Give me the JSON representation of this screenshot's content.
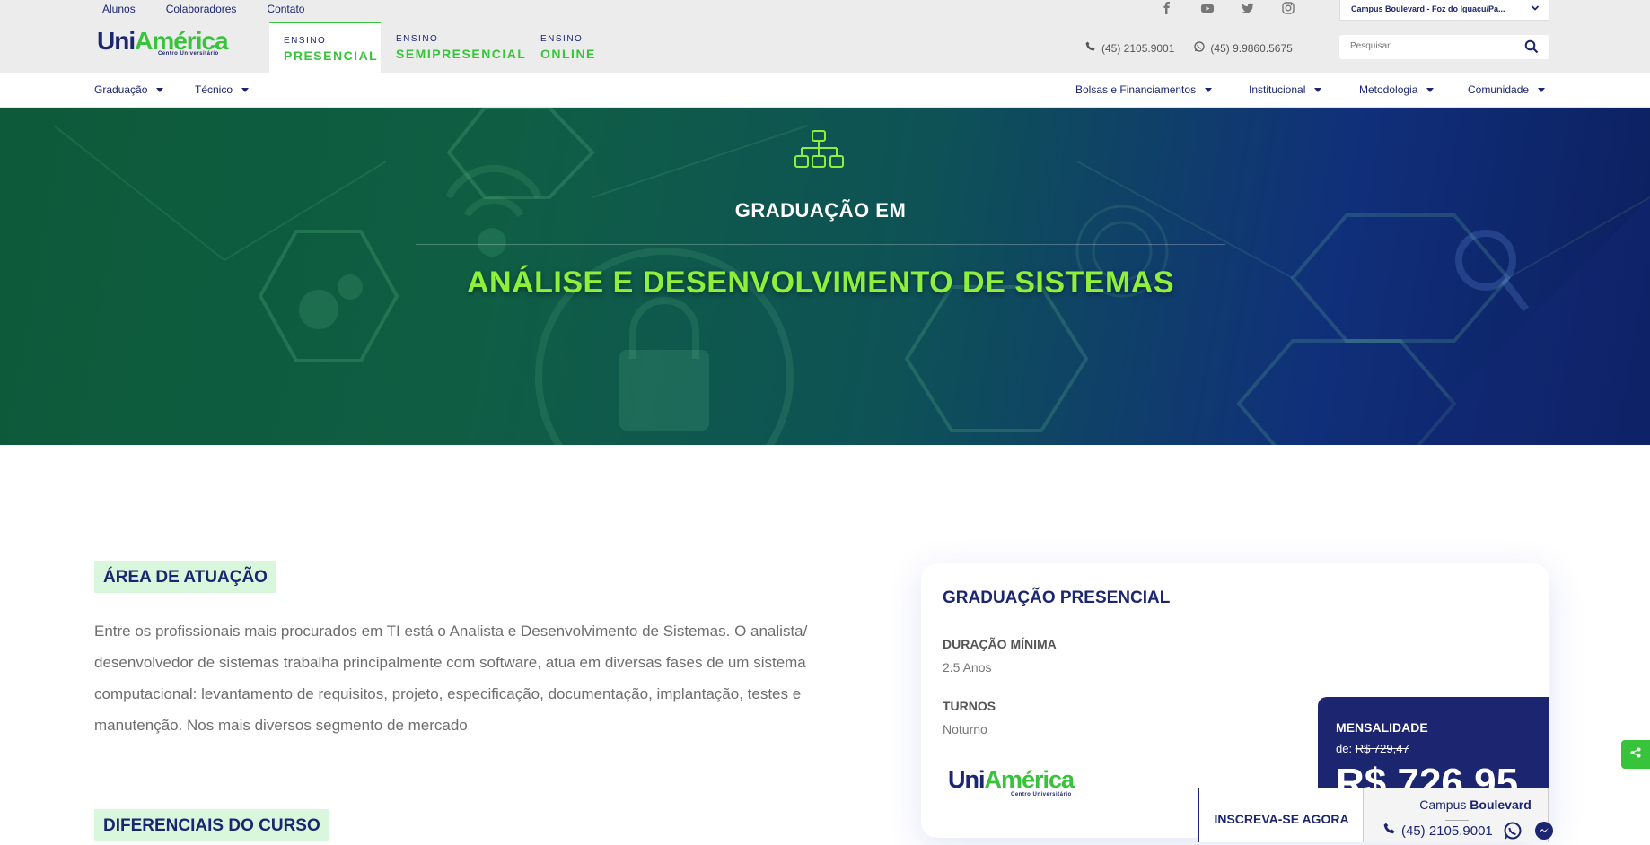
{
  "top_links": [
    "Alunos",
    "Colaboradores",
    "Contato"
  ],
  "brand": {
    "uni": "Uni",
    "america": "América",
    "sub": "Centro Universitário"
  },
  "ensino": [
    {
      "k": "ENSINO",
      "v": "PRESENCIAL"
    },
    {
      "k": "ENSINO",
      "v": "SEMIPRESENCIAL"
    },
    {
      "k": "ENSINO",
      "v": "ONLINE"
    }
  ],
  "social_icons": [
    "facebook-icon",
    "youtube-icon",
    "twitter-icon",
    "instagram-icon"
  ],
  "campus_select": "Campus Boulevard - Foz do Iguaçu/Pa...",
  "phones": {
    "phone": "(45) 2105.9001",
    "whatsapp": "(45) 9.9860.5675"
  },
  "search": {
    "placeholder": "Pesquisar"
  },
  "nav_left": [
    "Graduação",
    "Técnico"
  ],
  "nav_right": [
    "Bolsas e Financiamentos",
    "Institucional",
    "Metodologia",
    "Comunidade"
  ],
  "hero": {
    "subtitle": "GRADUAÇÃO EM",
    "title": "ANÁLISE E DESENVOLVIMENTO DE SISTEMAS"
  },
  "area": {
    "heading": "ÁREA DE ATUAÇÃO",
    "text": "Entre os profissionais mais procurados em TI está o Analista e Desenvolvimento de Sistemas. O analista/ desenvolvedor de sistemas trabalha principalmente com software,  atua em diversas fases de um sistema computacional: levantamento de requisitos, projeto, especificação, documentação, implantação, testes e manutenção.  Nos mais diversos segmento de mercado"
  },
  "diferenciais": {
    "heading": "DIFERENCIAIS DO CURSO"
  },
  "card": {
    "title": "GRADUAÇÃO PRESENCIAL",
    "duracao_label": "DURAÇÃO MÍNIMA",
    "duracao_value": "2.5 Anos",
    "turnos_label": "TURNOS",
    "turnos_value": "Noturno"
  },
  "price": {
    "label": "MENSALIDADE",
    "de": "de:",
    "old": "R$ 729,47",
    "new": "R$ 726,95"
  },
  "cta": {
    "label": "INSCREVA-SE AGORA"
  },
  "campus_box": {
    "prefix": "Campus",
    "name": "Boulevard",
    "phone": "(45) 2105.9001"
  },
  "colors": {
    "navy": "#1c2570",
    "green": "#37c43a",
    "lime": "#8ef03a"
  }
}
